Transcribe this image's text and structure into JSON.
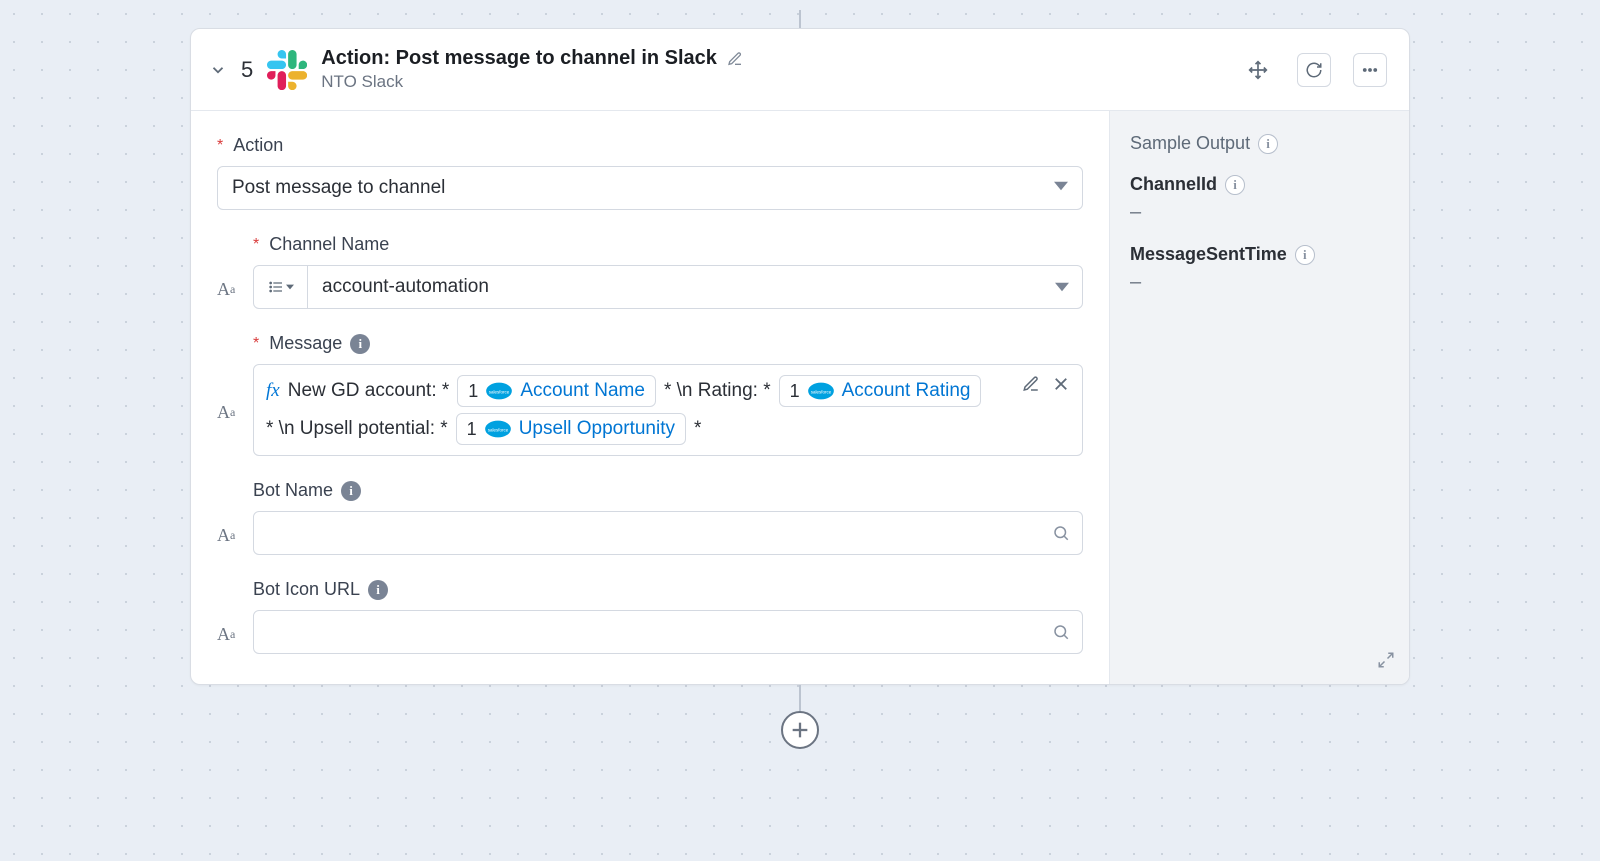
{
  "header": {
    "step_number": "5",
    "title": "Action: Post message to channel in Slack",
    "subtitle": "NTO Slack"
  },
  "form": {
    "action_label": "Action",
    "action_value": "Post message to channel",
    "channel_label": "Channel Name",
    "channel_value": "account-automation",
    "message_label": "Message",
    "message": {
      "t1": "New GD account: *",
      "p1_num": "1",
      "p1_name": "Account Name",
      "t2": "* \\n Rating: *",
      "p2_num": "1",
      "p2_name": "Account Rating",
      "t3": "* \\n Upsell potential: *",
      "p3_num": "1",
      "p3_name": "Upsell Opportunity",
      "t4": "*"
    },
    "botname_label": "Bot Name",
    "boticon_label": "Bot Icon URL"
  },
  "sample": {
    "heading": "Sample Output",
    "k1": "ChannelId",
    "v1": "–",
    "k2": "MessageSentTime",
    "v2": "–"
  }
}
